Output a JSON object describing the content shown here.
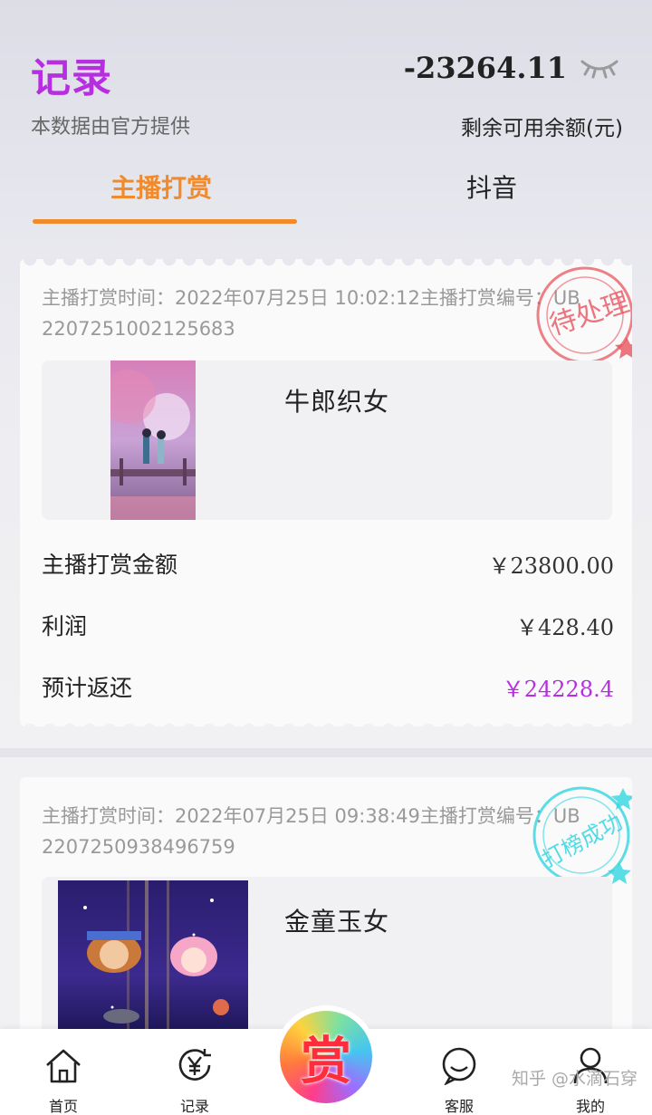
{
  "header": {
    "title": "记录",
    "subtitle": "本数据由官方提供",
    "balance": "-23264.11",
    "balance_label": "剩余可用余额(元)",
    "balance_toggle_icon": "eye-closed-icon"
  },
  "tabs": [
    {
      "label": "主播打赏",
      "active": true
    },
    {
      "label": "抖音",
      "active": false
    }
  ],
  "records": [
    {
      "meta": "主播打赏时间：2022年07月25日 10:02:12主播打赏编号：UB2207251002125683",
      "item_name": "牛郎织女",
      "stamp_text": "待处理",
      "stamp_color": "#e8555f",
      "rows": [
        {
          "label": "主播打赏金额",
          "value": "￥23800.00"
        },
        {
          "label": "利润",
          "value": "￥428.40"
        },
        {
          "label": "预计返还",
          "value": "￥24228.4"
        }
      ]
    },
    {
      "meta": "主播打赏时间：2022年07月25日 09:38:49主播打赏编号：UB2207250938496759",
      "item_name": "金童玉女",
      "stamp_text": "打榜成功",
      "stamp_color": "#33d6e0"
    }
  ],
  "bottom_nav": {
    "home": {
      "label": "首页",
      "icon": "home-icon"
    },
    "record": {
      "label": "记录",
      "icon": "yuan-record-icon"
    },
    "center": {
      "label": "赏",
      "icon": "reward-icon"
    },
    "service": {
      "label": "客服",
      "icon": "chat-icon"
    },
    "mine": {
      "label": "我的",
      "icon": "user-icon"
    }
  },
  "watermark": "知乎 @水滴石穿",
  "colors": {
    "accent_purple": "#b62ee0",
    "tab_orange": "#f08a2b"
  }
}
